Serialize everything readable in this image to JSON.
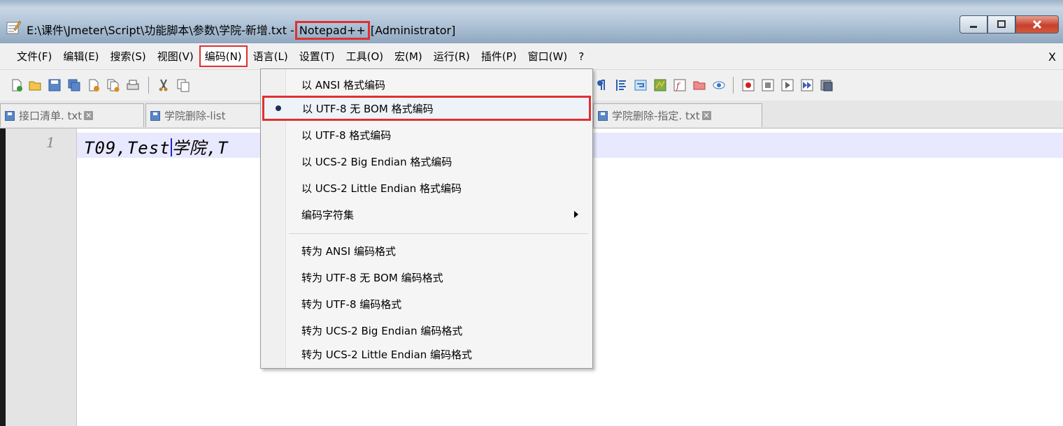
{
  "window": {
    "title_path": "E:\\课件\\Jmeter\\Script\\功能脚本\\参数\\学院-新增.txt - ",
    "title_app": "Notepad++",
    "title_suffix": " [Administrator]"
  },
  "menubar": {
    "items": [
      "文件(F)",
      "编辑(E)",
      "搜索(S)",
      "视图(V)",
      "编码(N)",
      "语言(L)",
      "设置(T)",
      "工具(O)",
      "宏(M)",
      "运行(R)",
      "插件(P)",
      "窗口(W)",
      "?"
    ],
    "close_label": "X"
  },
  "tabs": [
    {
      "label": "接口清单. txt"
    },
    {
      "label": "学院删除-list"
    },
    {
      "label": "学院删除-指定. txt"
    }
  ],
  "editor": {
    "line_number": "1",
    "text_before_caret": "T09,Test",
    "text_after_caret": "学院,T"
  },
  "encoding_menu": {
    "items": [
      {
        "label": "以 ANSI 格式编码"
      },
      {
        "label": "以 UTF-8 无 BOM 格式编码"
      },
      {
        "label": "以 UTF-8 格式编码"
      },
      {
        "label": "以 UCS-2 Big Endian 格式编码"
      },
      {
        "label": "以 UCS-2 Little Endian 格式编码"
      },
      {
        "label": "编码字符集"
      },
      {
        "label": "转为 ANSI 编码格式"
      },
      {
        "label": "转为 UTF-8 无 BOM 编码格式"
      },
      {
        "label": "转为 UTF-8 编码格式"
      },
      {
        "label": "转为 UCS-2 Big Endian 编码格式"
      },
      {
        "label": "转为 UCS-2 Little Endian 编码格式"
      }
    ],
    "selected_item": "以 UTF-8 无 BOM 格式编码"
  },
  "colors": {
    "highlight_box": "#e03030",
    "current_line": "#e8e8ff",
    "caret": "#2222cc"
  },
  "icons": [
    "notepadpp-app-icon",
    "minimize-icon",
    "maximize-icon",
    "close-icon",
    "new-file-icon",
    "open-file-icon",
    "save-icon",
    "save-all-icon",
    "close-file-icon",
    "close-all-icon",
    "print-icon",
    "cut-icon",
    "copy-icon",
    "show-all-chars-icon",
    "indent-guide-icon",
    "word-wrap-icon",
    "doc-map-icon",
    "function-list-icon",
    "folder-as-workspace-icon",
    "monitoring-icon",
    "record-macro-icon",
    "stop-macro-icon",
    "play-macro-icon",
    "run-macro-multiple-icon",
    "save-macro-icon",
    "radio-selected-icon",
    "submenu-arrow-icon",
    "tab-save-icon",
    "tab-close-icon"
  ]
}
